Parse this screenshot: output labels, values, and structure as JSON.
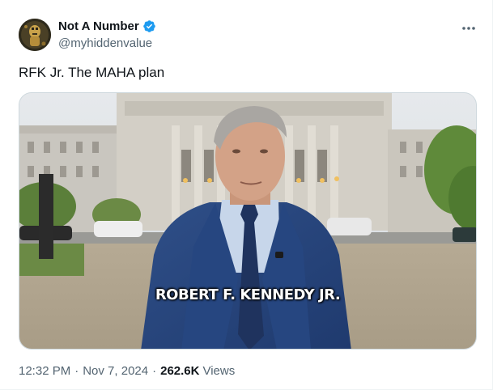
{
  "author": {
    "name": "Not A Number",
    "handle": "@myhiddenvalue",
    "verified": true,
    "verified_color": "#1d9bf0"
  },
  "tweet": {
    "text": "RFK Jr. The MAHA plan"
  },
  "media": {
    "caption": "ROBERT F. KENNEDY JR."
  },
  "meta": {
    "time": "12:32 PM",
    "separator": "·",
    "date": "Nov 7, 2024",
    "views_count": "262.6K",
    "views_label": "Views"
  },
  "icons": {
    "more": "more-dots-icon",
    "verified": "verified-badge-icon"
  }
}
